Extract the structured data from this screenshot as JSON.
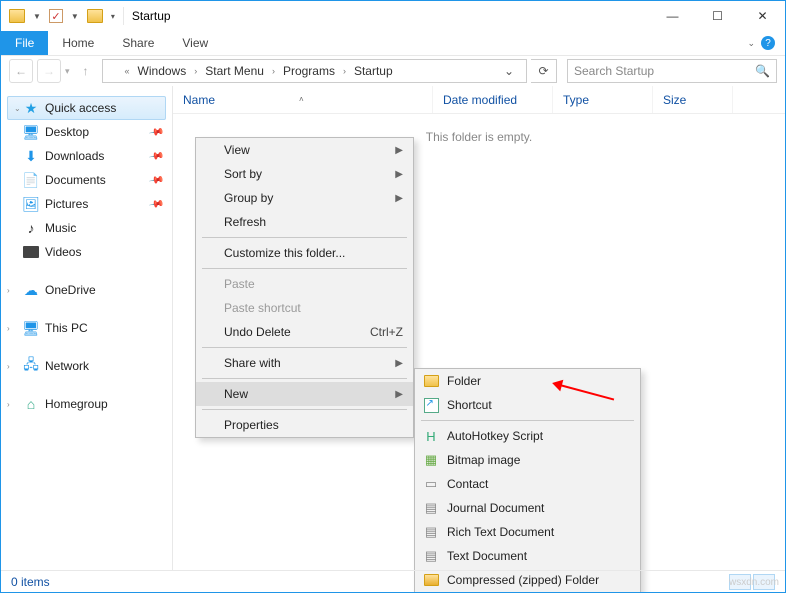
{
  "titlebar": {
    "title": "Startup"
  },
  "ribbon": {
    "file": "File",
    "tabs": [
      "Home",
      "Share",
      "View"
    ]
  },
  "breadcrumb": {
    "items": [
      "Windows",
      "Start Menu",
      "Programs",
      "Startup"
    ]
  },
  "search": {
    "placeholder": "Search Startup"
  },
  "nav": {
    "quick_access": "Quick access",
    "pinned": [
      {
        "icon": "monitor",
        "label": "Desktop"
      },
      {
        "icon": "arrowdn",
        "label": "Downloads"
      },
      {
        "icon": "doc",
        "label": "Documents"
      },
      {
        "icon": "pic",
        "label": "Pictures"
      }
    ],
    "recent": [
      {
        "icon": "music",
        "label": "Music"
      },
      {
        "icon": "vid",
        "label": "Videos"
      }
    ],
    "roots": [
      {
        "icon": "cloud",
        "label": "OneDrive"
      },
      {
        "icon": "pc",
        "label": "This PC"
      },
      {
        "icon": "net",
        "label": "Network"
      },
      {
        "icon": "home",
        "label": "Homegroup"
      }
    ]
  },
  "columns": {
    "name": "Name",
    "date": "Date modified",
    "type": "Type",
    "size": "Size"
  },
  "empty_msg": "This folder is empty.",
  "context_menu": {
    "view": "View",
    "sort_by": "Sort by",
    "group_by": "Group by",
    "refresh": "Refresh",
    "customize": "Customize this folder...",
    "paste": "Paste",
    "paste_shortcut": "Paste shortcut",
    "undo_delete": "Undo Delete",
    "undo_shortcut": "Ctrl+Z",
    "share_with": "Share with",
    "new": "New",
    "properties": "Properties"
  },
  "new_submenu": {
    "items": [
      {
        "label": "Folder",
        "icon": "folder"
      },
      {
        "label": "Shortcut",
        "icon": "shortcut"
      },
      {
        "label": "AutoHotkey Script",
        "icon": "ahk"
      },
      {
        "label": "Bitmap image",
        "icon": "bmp"
      },
      {
        "label": "Contact",
        "icon": "contact"
      },
      {
        "label": "Journal Document",
        "icon": "journal"
      },
      {
        "label": "Rich Text Document",
        "icon": "rtf"
      },
      {
        "label": "Text Document",
        "icon": "txt"
      },
      {
        "label": "Compressed (zipped) Folder",
        "icon": "zip"
      }
    ]
  },
  "status": {
    "count": "0 items"
  },
  "watermark": "wsxdn.com"
}
